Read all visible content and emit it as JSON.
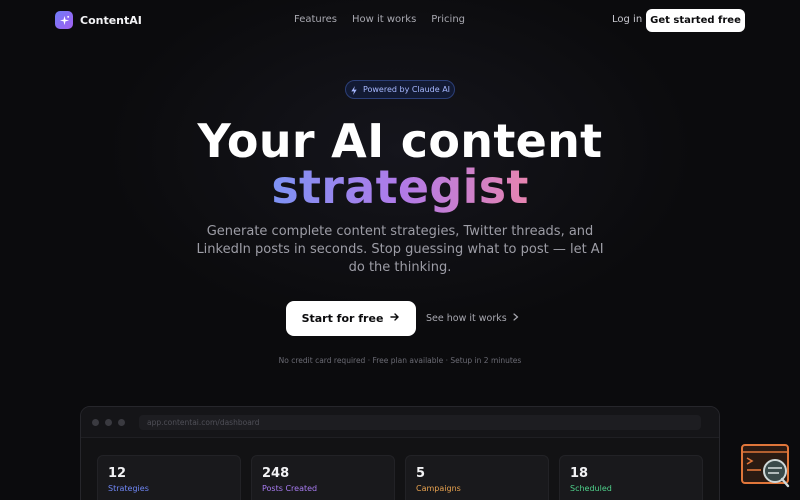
{
  "nav": {
    "brand": "ContentAI",
    "links": [
      "Features",
      "How it works",
      "Pricing"
    ],
    "login": "Log in",
    "cta": "Get started free"
  },
  "hero": {
    "badge": "Powered by Claude AI",
    "title_line1": "Your AI content",
    "title_line2": "strategist",
    "subtitle": "Generate complete content strategies, Twitter threads, and LinkedIn posts in seconds. Stop guessing what to post — let AI do the thinking.",
    "primary_cta": "Start for free",
    "secondary_cta": "See how it works",
    "note": "No credit card required · Free plan available · Setup in 2 minutes"
  },
  "preview": {
    "url": "app.contentai.com/dashboard",
    "stats": [
      {
        "value": "12",
        "label": "Strategies",
        "color": "#6f86f5"
      },
      {
        "value": "248",
        "label": "Posts Created",
        "color": "#a77bf0"
      },
      {
        "value": "5",
        "label": "Campaigns",
        "color": "#e8a24f"
      },
      {
        "value": "18",
        "label": "Scheduled",
        "color": "#4fd18b"
      }
    ]
  },
  "colors": {
    "background": "#0b0b0d",
    "accent_gradient_start": "#7d93f4",
    "accent_gradient_end": "#e784b0",
    "badge_text": "#a7b8ff"
  },
  "icons": [
    "sparkle-logo-icon",
    "lightning-icon",
    "arrow-right-icon",
    "chevron-right-icon",
    "help-widget-icon"
  ]
}
